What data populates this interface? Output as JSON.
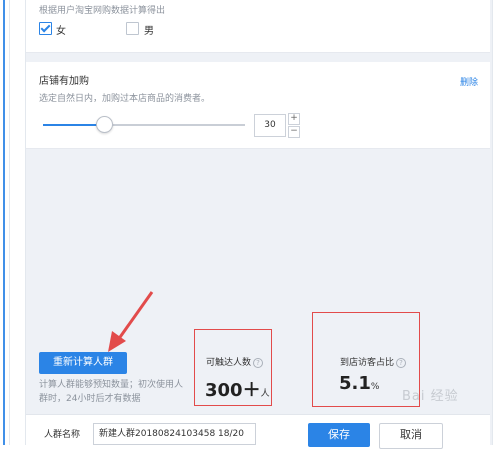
{
  "gender_card": {
    "description": "根据用户淘宝网购数据计算得出",
    "options": [
      {
        "label": "女",
        "checked": true
      },
      {
        "label": "男",
        "checked": false
      }
    ]
  },
  "shop_card": {
    "title": "店铺有加购",
    "description": "选定自然日内，加购过本店商品的消费者。",
    "delete_label": "删除",
    "days_value": "30",
    "slider_fraction": 0.3,
    "stepper_up": "+",
    "stepper_down": "−"
  },
  "recalc": {
    "button_label": "重新计算人群",
    "note": "计算人群能够预知数量；初次使用人群时，24小时后才有数据"
  },
  "stats": {
    "reach": {
      "label": "可触达人数",
      "value": "300＋",
      "unit": "人"
    },
    "share": {
      "label": "到店访客占比",
      "value": "5.1",
      "unit": "%"
    },
    "help_glyph": "?"
  },
  "footer": {
    "name_label": "人群名称",
    "name_value": "新建人群20180824103458   18/20",
    "save_label": "保存",
    "cancel_label": "取消"
  },
  "watermark": "Bai 经验",
  "colors": {
    "accent": "#2b84e6",
    "annotation_red": "#e24b4b"
  }
}
